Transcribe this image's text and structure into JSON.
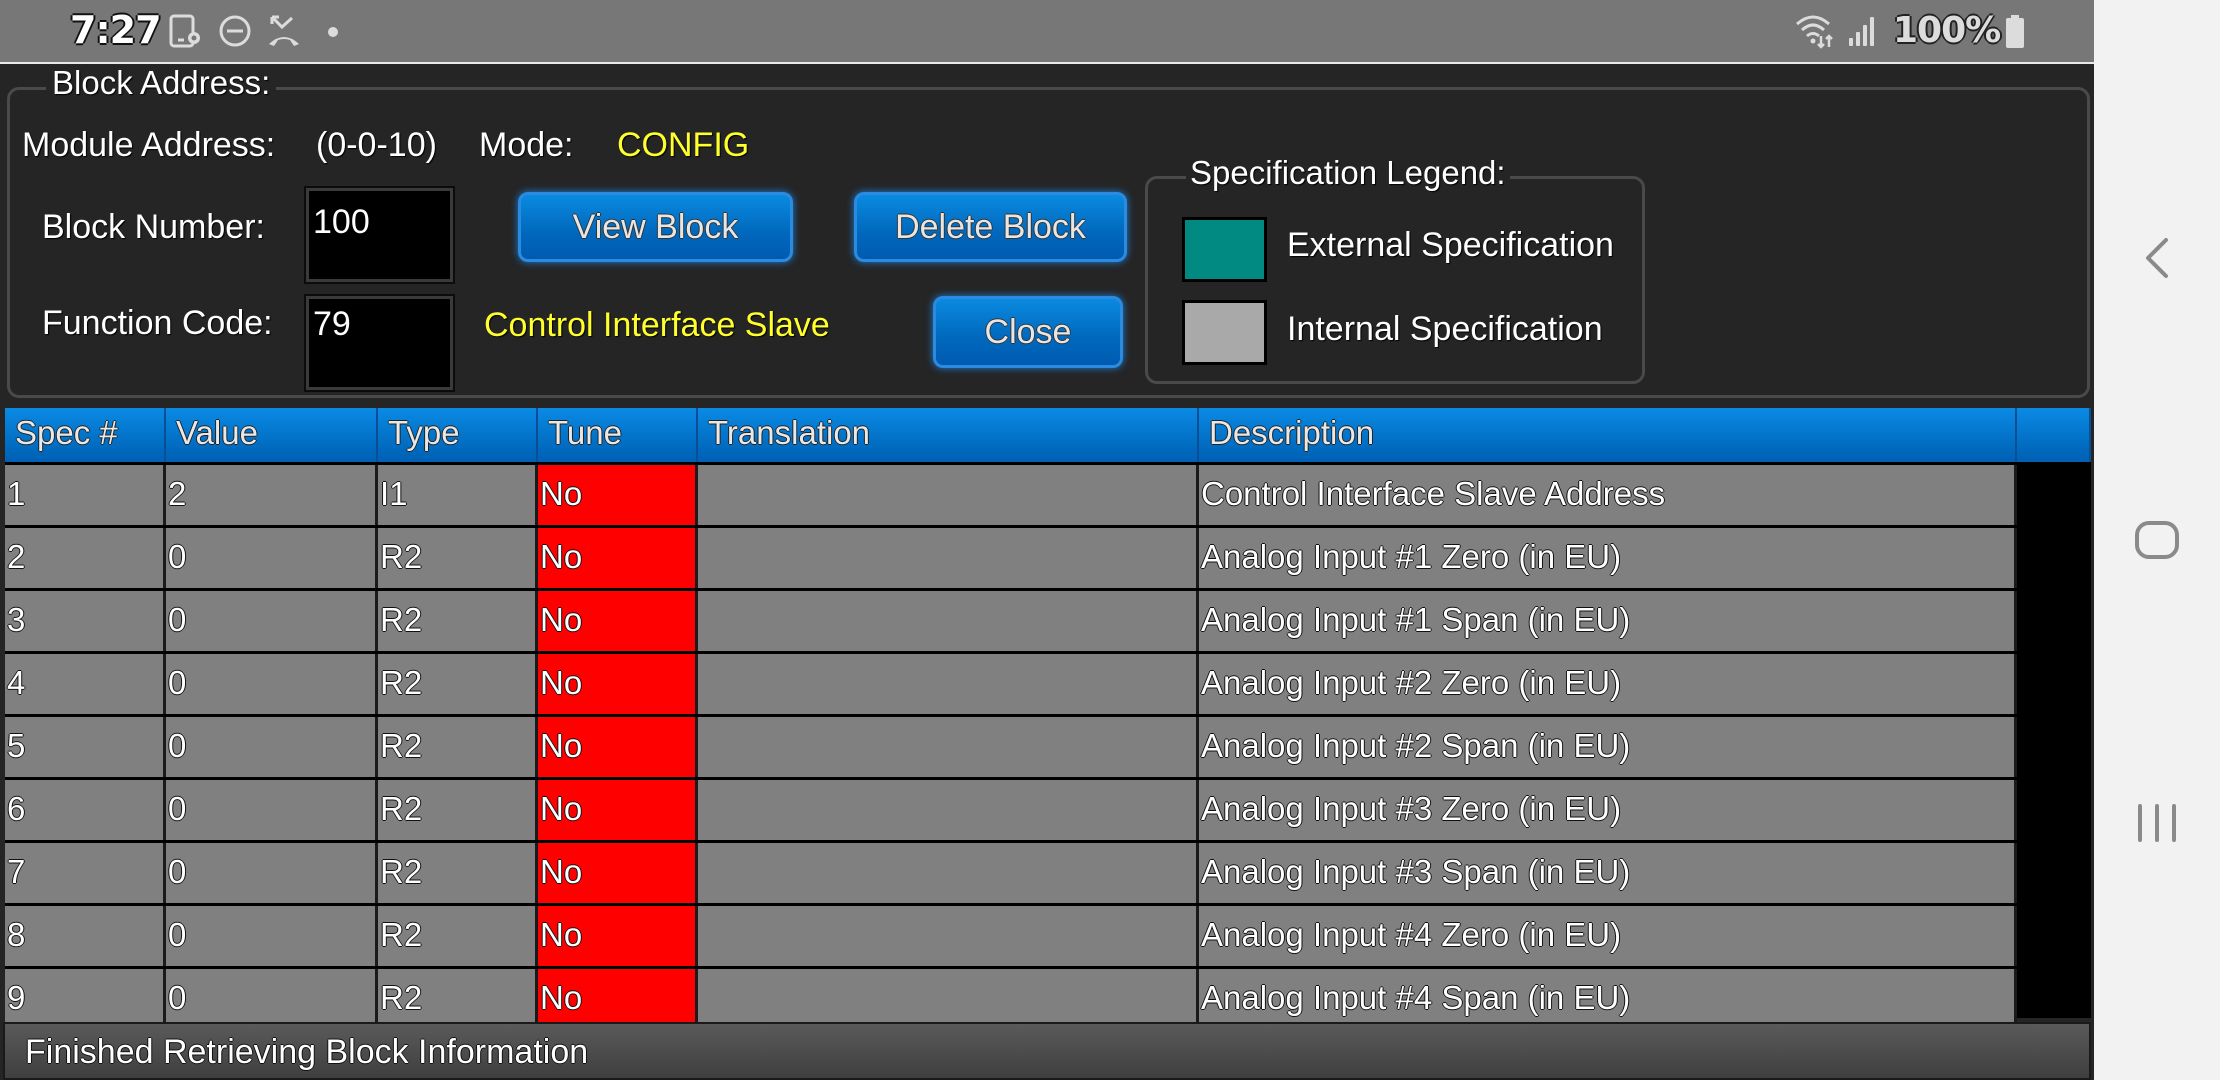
{
  "status_bar": {
    "time": "7:27",
    "battery_percent": "100%",
    "left_icons": [
      "location-device-icon",
      "do-not-disturb-icon",
      "missed-call-icon",
      "notification-dot-icon"
    ],
    "right_icons": [
      "wifi-icon",
      "signal-icon",
      "battery-icon"
    ]
  },
  "block_address": {
    "title": "Block Address:",
    "module_address_label": "Module Address:",
    "module_address_value": "(0-0-10)",
    "mode_label": "Mode:",
    "mode_value": "CONFIG",
    "block_number_label": "Block Number:",
    "block_number_value": "100",
    "function_code_label": "Function Code:",
    "function_code_value": "79",
    "function_name": "Control Interface Slave",
    "view_block_label": "View Block",
    "delete_block_label": "Delete Block",
    "close_label": "Close"
  },
  "legend": {
    "title": "Specification Legend:",
    "items": [
      {
        "label": "External Specification",
        "color": "#008a82"
      },
      {
        "label": "Internal Specification",
        "color": "#a9a9a9"
      }
    ]
  },
  "table": {
    "columns": [
      "Spec #",
      "Value",
      "Type",
      "Tune",
      "Translation",
      "Description",
      ""
    ],
    "rows": [
      {
        "spec": "1",
        "value": "2",
        "type": "I1",
        "tune": "No",
        "translation": "",
        "description": "Control Interface Slave Address"
      },
      {
        "spec": "2",
        "value": "0",
        "type": "R2",
        "tune": "No",
        "translation": "",
        "description": "Analog Input #1 Zero (in EU)"
      },
      {
        "spec": "3",
        "value": "0",
        "type": "R2",
        "tune": "No",
        "translation": "",
        "description": "Analog Input #1 Span (in EU)"
      },
      {
        "spec": "4",
        "value": "0",
        "type": "R2",
        "tune": "No",
        "translation": "",
        "description": "Analog Input #2 Zero (in EU)"
      },
      {
        "spec": "5",
        "value": "0",
        "type": "R2",
        "tune": "No",
        "translation": "",
        "description": "Analog Input #2 Span (in EU)"
      },
      {
        "spec": "6",
        "value": "0",
        "type": "R2",
        "tune": "No",
        "translation": "",
        "description": "Analog Input #3 Zero (in EU)"
      },
      {
        "spec": "7",
        "value": "0",
        "type": "R2",
        "tune": "No",
        "translation": "",
        "description": "Analog Input #3 Span (in EU)"
      },
      {
        "spec": "8",
        "value": "0",
        "type": "R2",
        "tune": "No",
        "translation": "",
        "description": "Analog Input #4 Zero (in EU)"
      },
      {
        "spec": "9",
        "value": "0",
        "type": "R2",
        "tune": "No",
        "translation": "",
        "description": "Analog Input #4 Span (in EU)"
      }
    ]
  },
  "status_message": "Finished Retrieving Block Information",
  "colors": {
    "tune_no": "#ff0000",
    "header_blue": "#0070c8",
    "accent_yellow": "#ffff2e",
    "internal_spec": "#a9a9a9",
    "external_spec": "#008a82"
  },
  "nav": {
    "buttons": [
      "back-icon",
      "home-icon",
      "recents-icon"
    ]
  }
}
